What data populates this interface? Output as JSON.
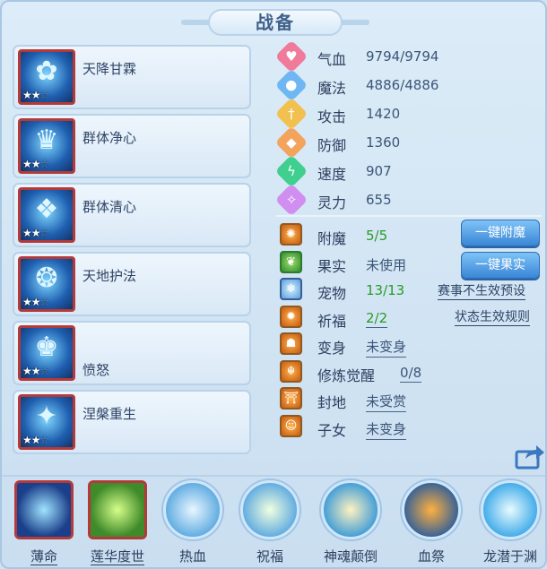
{
  "panel": {
    "title": "战备"
  },
  "skills": [
    {
      "name": "天降甘霖",
      "stars_on": "★★",
      "stars_off": "☆",
      "icon": "rain-flower-icon",
      "name_low": false
    },
    {
      "name": "群体净心",
      "stars_on": "★★",
      "stars_off": "☆",
      "icon": "armored-head-icon",
      "name_low": false
    },
    {
      "name": "群体清心",
      "stars_on": "★★",
      "stars_off": "☆",
      "icon": "winged-crest-icon",
      "name_low": false
    },
    {
      "name": "天地护法",
      "stars_on": "★★",
      "stars_off": "☆",
      "icon": "swirl-guardian-icon",
      "name_low": false
    },
    {
      "name": "愤怒",
      "stars_on": "★★",
      "stars_off": "☆",
      "icon": "crown-flame-icon",
      "name_low": true
    },
    {
      "name": "涅槃重生",
      "stars_on": "★★",
      "stars_off": "☆",
      "icon": "rebirth-phoenix-icon",
      "name_low": false
    }
  ],
  "attributes": [
    {
      "label": "气血",
      "value": "9794/9794",
      "icon": "heart-icon",
      "color": "#f07a9a"
    },
    {
      "label": "魔法",
      "value": "4886/4886",
      "icon": "mana-icon",
      "color": "#6fb7f2"
    },
    {
      "label": "攻击",
      "value": "1420",
      "icon": "sword-icon",
      "color": "#f1c04e"
    },
    {
      "label": "防御",
      "value": "1360",
      "icon": "shield-icon",
      "color": "#f3a35c"
    },
    {
      "label": "速度",
      "value": "907",
      "icon": "lightning-icon",
      "color": "#3fcf8e"
    },
    {
      "label": "灵力",
      "value": "655",
      "icon": "spirit-icon",
      "color": "#d08ef0"
    }
  ],
  "status": [
    {
      "label": "附魔",
      "value": "5/5",
      "icon": "enchant-icon",
      "value_color": "green"
    },
    {
      "label": "果实",
      "value": "未使用",
      "icon": "fruit-icon",
      "value_color": "normal"
    },
    {
      "label": "宠物",
      "value": "13/13",
      "icon": "pet-icon",
      "value_color": "green"
    },
    {
      "label": "祈福",
      "value": "2/2",
      "icon": "pray-icon",
      "value_color": "green"
    },
    {
      "label": "变身",
      "value": "未变身",
      "icon": "transform-icon",
      "value_color": "normal"
    },
    {
      "label": "修炼觉醒",
      "value": "0/8",
      "icon": "cultivation-icon",
      "value_color": "normal"
    },
    {
      "label": "封地",
      "value": "未受赏",
      "icon": "fief-icon",
      "value_color": "normal"
    },
    {
      "label": "子女",
      "value": "未变身",
      "icon": "child-icon",
      "value_color": "normal"
    }
  ],
  "buttons": {
    "enchant": "一键附魔",
    "fruit": "一键果实"
  },
  "links": {
    "preset": "赛事不生效预设",
    "rules": "状态生效规则"
  },
  "bottom": [
    {
      "label": "薄命",
      "icon": "blue-orb-icon",
      "shape": "square",
      "c1": "#9fe4ff",
      "c2": "#1b3f8a"
    },
    {
      "label": "莲华度世",
      "icon": "lotus-hand-icon",
      "shape": "square",
      "c1": "#d6ff8a",
      "c2": "#3f8a2a"
    },
    {
      "label": "热血",
      "icon": "warrior-icon",
      "shape": "round",
      "c1": "#e8f6ff",
      "c2": "#5aa8e0"
    },
    {
      "label": "祝福",
      "icon": "leaf-blessing-icon",
      "shape": "round",
      "c1": "#f0ffe0",
      "c2": "#5aa8e0"
    },
    {
      "label": "神魂颠倒",
      "icon": "spin-soul-icon",
      "shape": "round",
      "c1": "#fff2c0",
      "c2": "#3a9ad8"
    },
    {
      "label": "血祭",
      "icon": "blood-sacrifice-icon",
      "shape": "round",
      "c1": "#ffb040",
      "c2": "#2f5e9a"
    },
    {
      "label": "龙潜于渊",
      "icon": "dragon-icon",
      "shape": "round",
      "c1": "#e8fbff",
      "c2": "#3aa8e8"
    }
  ]
}
